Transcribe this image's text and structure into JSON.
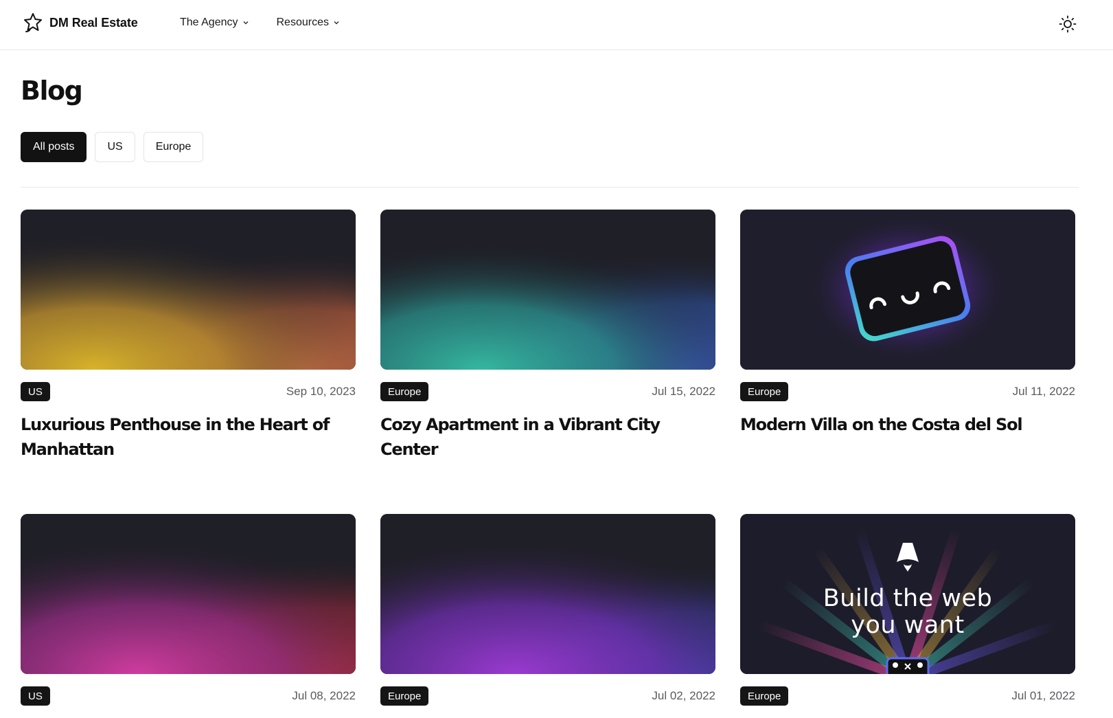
{
  "header": {
    "brand": "DM Real Estate",
    "nav": [
      {
        "label": "The Agency"
      },
      {
        "label": "Resources"
      }
    ]
  },
  "page": {
    "title": "Blog"
  },
  "filters": [
    {
      "label": "All posts",
      "active": true
    },
    {
      "label": "US",
      "active": false
    },
    {
      "label": "Europe",
      "active": false
    }
  ],
  "posts": [
    {
      "category": "US",
      "date": "Sep 10, 2023",
      "title": "Luxurious Penthouse in the Heart of Manhattan",
      "image": "gradient-yellow-orange"
    },
    {
      "category": "Europe",
      "date": "Jul 15, 2022",
      "title": "Cozy Apartment in a Vibrant City Center",
      "image": "gradient-teal-blue"
    },
    {
      "category": "Europe",
      "date": "Jul 11, 2022",
      "title": "Modern Villa on the Costa del Sol",
      "image": "smiling-box-illustration"
    },
    {
      "category": "US",
      "date": "Jul 08, 2022",
      "title": "",
      "image": "gradient-magenta-red"
    },
    {
      "category": "Europe",
      "date": "Jul 02, 2022",
      "title": "",
      "image": "gradient-purple-blue"
    },
    {
      "category": "Europe",
      "date": "Jul 01, 2022",
      "title": "",
      "image": "astro-launch-banner",
      "image_caption_line1": "Build the web",
      "image_caption_line2": "you want"
    }
  ],
  "colors": {
    "accent_dark": "#121212",
    "muted_text": "#5a5a5f",
    "border": "#e4e4e7"
  }
}
